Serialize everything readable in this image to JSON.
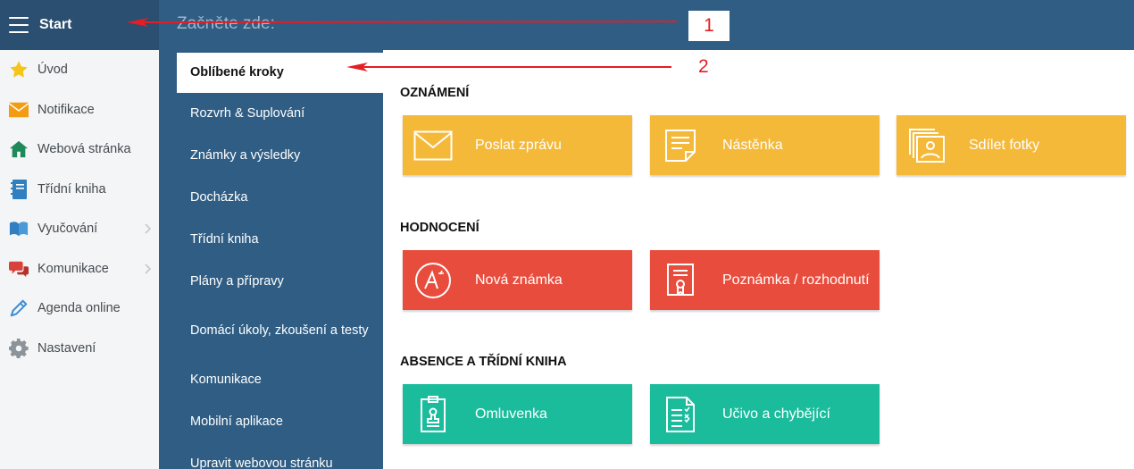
{
  "topbar": {
    "title": "Start",
    "search_placeholder": "Začněte zde:"
  },
  "sidebar": {
    "items": [
      {
        "label": "Úvod",
        "icon": "star-icon",
        "has_submenu": false
      },
      {
        "label": "Notifikace",
        "icon": "envelope-icon",
        "has_submenu": false
      },
      {
        "label": "Webová stránka",
        "icon": "home-icon",
        "has_submenu": false
      },
      {
        "label": "Třídní kniha",
        "icon": "notebook-icon",
        "has_submenu": false
      },
      {
        "label": "Vyučování",
        "icon": "open-book-icon",
        "has_submenu": true
      },
      {
        "label": "Komunikace",
        "icon": "chat-bubbles-icon",
        "has_submenu": true
      },
      {
        "label": "Agenda online",
        "icon": "pencil-icon",
        "has_submenu": false
      },
      {
        "label": "Nastavení",
        "icon": "gear-icon",
        "has_submenu": false
      }
    ]
  },
  "categories": {
    "items": [
      {
        "label": "Oblíbené kroky",
        "active": true
      },
      {
        "label": "Rozvrh & Suplování",
        "active": false
      },
      {
        "label": "Známky a výsledky",
        "active": false
      },
      {
        "label": "Docházka",
        "active": false
      },
      {
        "label": "Třídní kniha",
        "active": false
      },
      {
        "label": "Plány a přípravy",
        "active": false
      },
      {
        "label": "Domácí úkoly, zkoušení a testy",
        "active": false
      },
      {
        "label": "Komunikace",
        "active": false
      },
      {
        "label": "Mobilní aplikace",
        "active": false
      },
      {
        "label": "Upravit webovou stránku",
        "active": false
      }
    ]
  },
  "sections": [
    {
      "title": "OZNÁMENÍ",
      "color": "#f5b93a",
      "tiles": [
        {
          "label": "Poslat zprávu",
          "icon": "envelope-outline-icon"
        },
        {
          "label": "Nástěnka",
          "icon": "note-icon"
        },
        {
          "label": "Sdílet fotky",
          "icon": "photos-icon"
        }
      ]
    },
    {
      "title": "HODNOCENÍ",
      "color": "#e84c3d",
      "tiles": [
        {
          "label": "Nová známka",
          "icon": "grade-a-icon"
        },
        {
          "label": "Poznámka / rozhodnutí",
          "icon": "certificate-icon"
        }
      ]
    },
    {
      "title": "ABSENCE A TŘÍDNÍ KNIHA",
      "color": "#1abc9c",
      "tiles": [
        {
          "label": "Omluvenka",
          "icon": "clipboard-stamp-icon"
        },
        {
          "label": "Učivo a chybějící",
          "icon": "checklist-icon"
        }
      ]
    }
  ],
  "annotations": {
    "label_1": "1",
    "label_2": "2",
    "color": "#e31e24"
  }
}
